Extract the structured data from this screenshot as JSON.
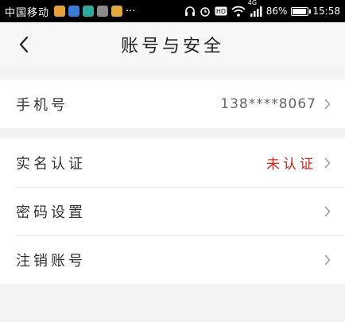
{
  "status_bar": {
    "carrier": "中国移动",
    "network": "4G",
    "battery": "86%",
    "time": "15:58"
  },
  "header": {
    "title": "账号与安全"
  },
  "groups": [
    {
      "rows": [
        {
          "label": "手机号",
          "value": "138****8067"
        }
      ]
    },
    {
      "rows": [
        {
          "label": "实名认证",
          "value": "未认证"
        },
        {
          "label": "密码设置"
        },
        {
          "label": "注销账号"
        }
      ]
    }
  ],
  "colors": {
    "warning": "#d0231a",
    "background": "#f3f3f3"
  }
}
